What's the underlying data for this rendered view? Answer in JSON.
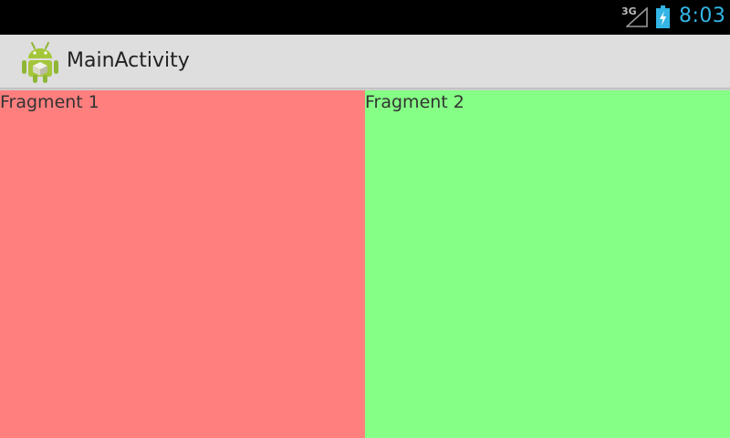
{
  "status_bar": {
    "network_type": "3G",
    "time": "8:03",
    "icons": [
      "signal-icon",
      "battery-charging-icon"
    ],
    "accent_color": "#33b5e5"
  },
  "action_bar": {
    "title": "MainActivity",
    "icon": "android-app-icon"
  },
  "fragments": [
    {
      "label": "Fragment 1",
      "color": "#ff7f7f"
    },
    {
      "label": "Fragment 2",
      "color": "#85ff85"
    }
  ]
}
